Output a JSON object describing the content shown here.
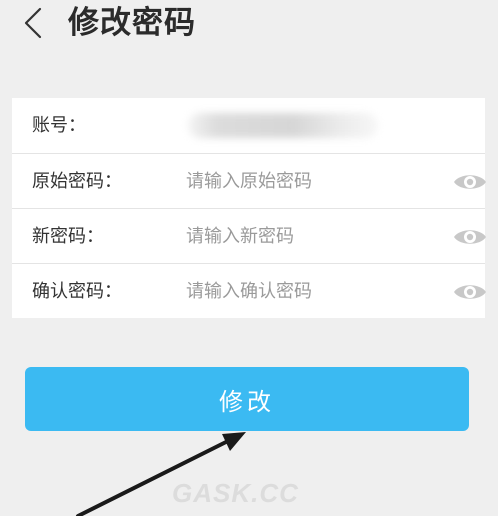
{
  "header": {
    "title": "修改密码",
    "back_icon": "chevron-left-icon"
  },
  "form": {
    "account": {
      "label": "账号：",
      "value_masked": true
    },
    "old_password": {
      "label": "原始密码：",
      "placeholder": "请输入原始密码",
      "icon": "eye-icon"
    },
    "new_password": {
      "label": "新密码：",
      "placeholder": "请输入新密码",
      "icon": "eye-icon"
    },
    "confirm_password": {
      "label": "确认密码：",
      "placeholder": "请输入确认密码",
      "icon": "eye-icon"
    }
  },
  "submit": {
    "label": "修改"
  },
  "annotation": {
    "icon": "arrow-icon",
    "color": "#1a1a1a"
  },
  "watermark": {
    "text": "GASK.CC"
  },
  "colors": {
    "background": "#efefef",
    "card": "#ffffff",
    "button": "#3bbaf2",
    "placeholder": "#9a9a9a",
    "eye": "#c8c8c8"
  }
}
